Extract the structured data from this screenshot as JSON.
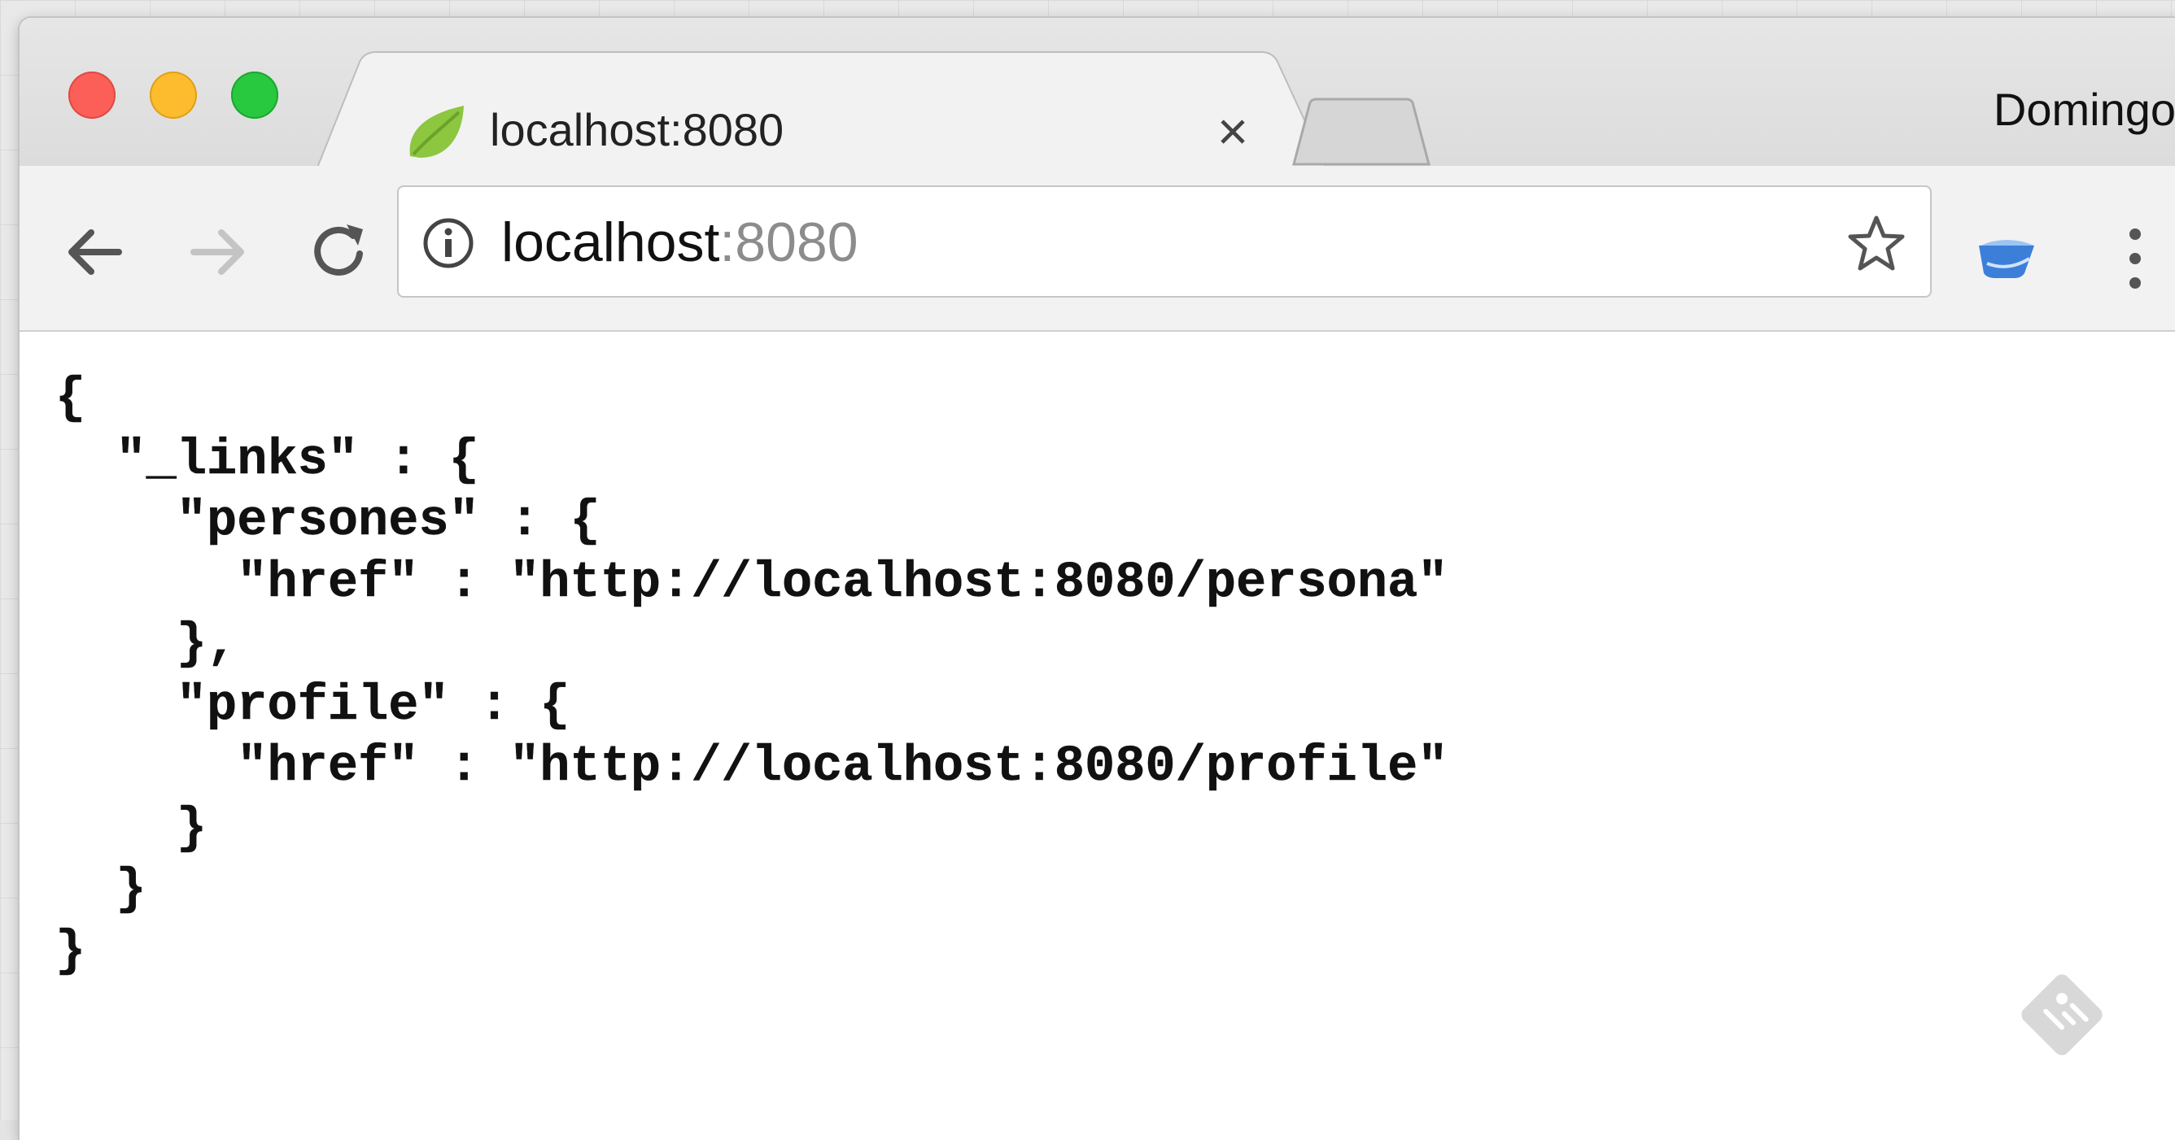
{
  "browser": {
    "active_tab": {
      "title": "localhost:8080",
      "favicon": "spring-leaf-icon",
      "close_label": "×"
    },
    "profile_name": "Domingo",
    "address_bar": {
      "host": "localhost",
      "port": ":8080"
    },
    "icons": {
      "back": "arrow-left-icon",
      "forward": "arrow-right-icon",
      "reload": "reload-icon",
      "info": "info-icon",
      "bookmark": "star-icon",
      "extension": "extension-icon",
      "menu": "kebab-menu-icon"
    },
    "colors": {
      "close": "#fc5f57",
      "minimize": "#fdbc2e",
      "maximize": "#28c83f",
      "favicon": "#8dc63f"
    }
  },
  "page": {
    "json_lines": [
      "{",
      "  \"_links\" : {",
      "    \"persones\" : {",
      "      \"href\" : \"http://localhost:8080/persona\"",
      "    },",
      "    \"profile\" : {",
      "      \"href\" : \"http://localhost:8080/profile\"",
      "    }",
      "  }",
      "}"
    ]
  }
}
